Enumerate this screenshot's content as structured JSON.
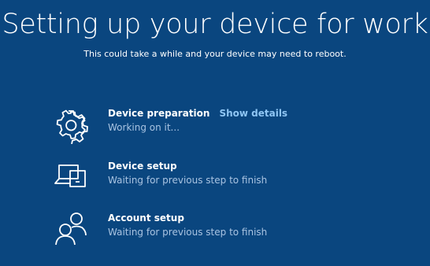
{
  "header": {
    "title": "Setting up your device for work",
    "subtitle": "This could take a while and your device may need to reboot."
  },
  "steps": [
    {
      "name": "Device preparation",
      "status": "Working on it...",
      "link": "Show details",
      "icon": "gear-icon"
    },
    {
      "name": "Device setup",
      "status": "Waiting for previous step to finish",
      "icon": "devices-icon"
    },
    {
      "name": "Account setup",
      "status": "Waiting for previous step to finish",
      "icon": "people-icon"
    }
  ],
  "colors": {
    "background": "#0a467f",
    "text": "#ffffff",
    "status_text": "#a9c4e2",
    "link": "#8fc6f4"
  }
}
